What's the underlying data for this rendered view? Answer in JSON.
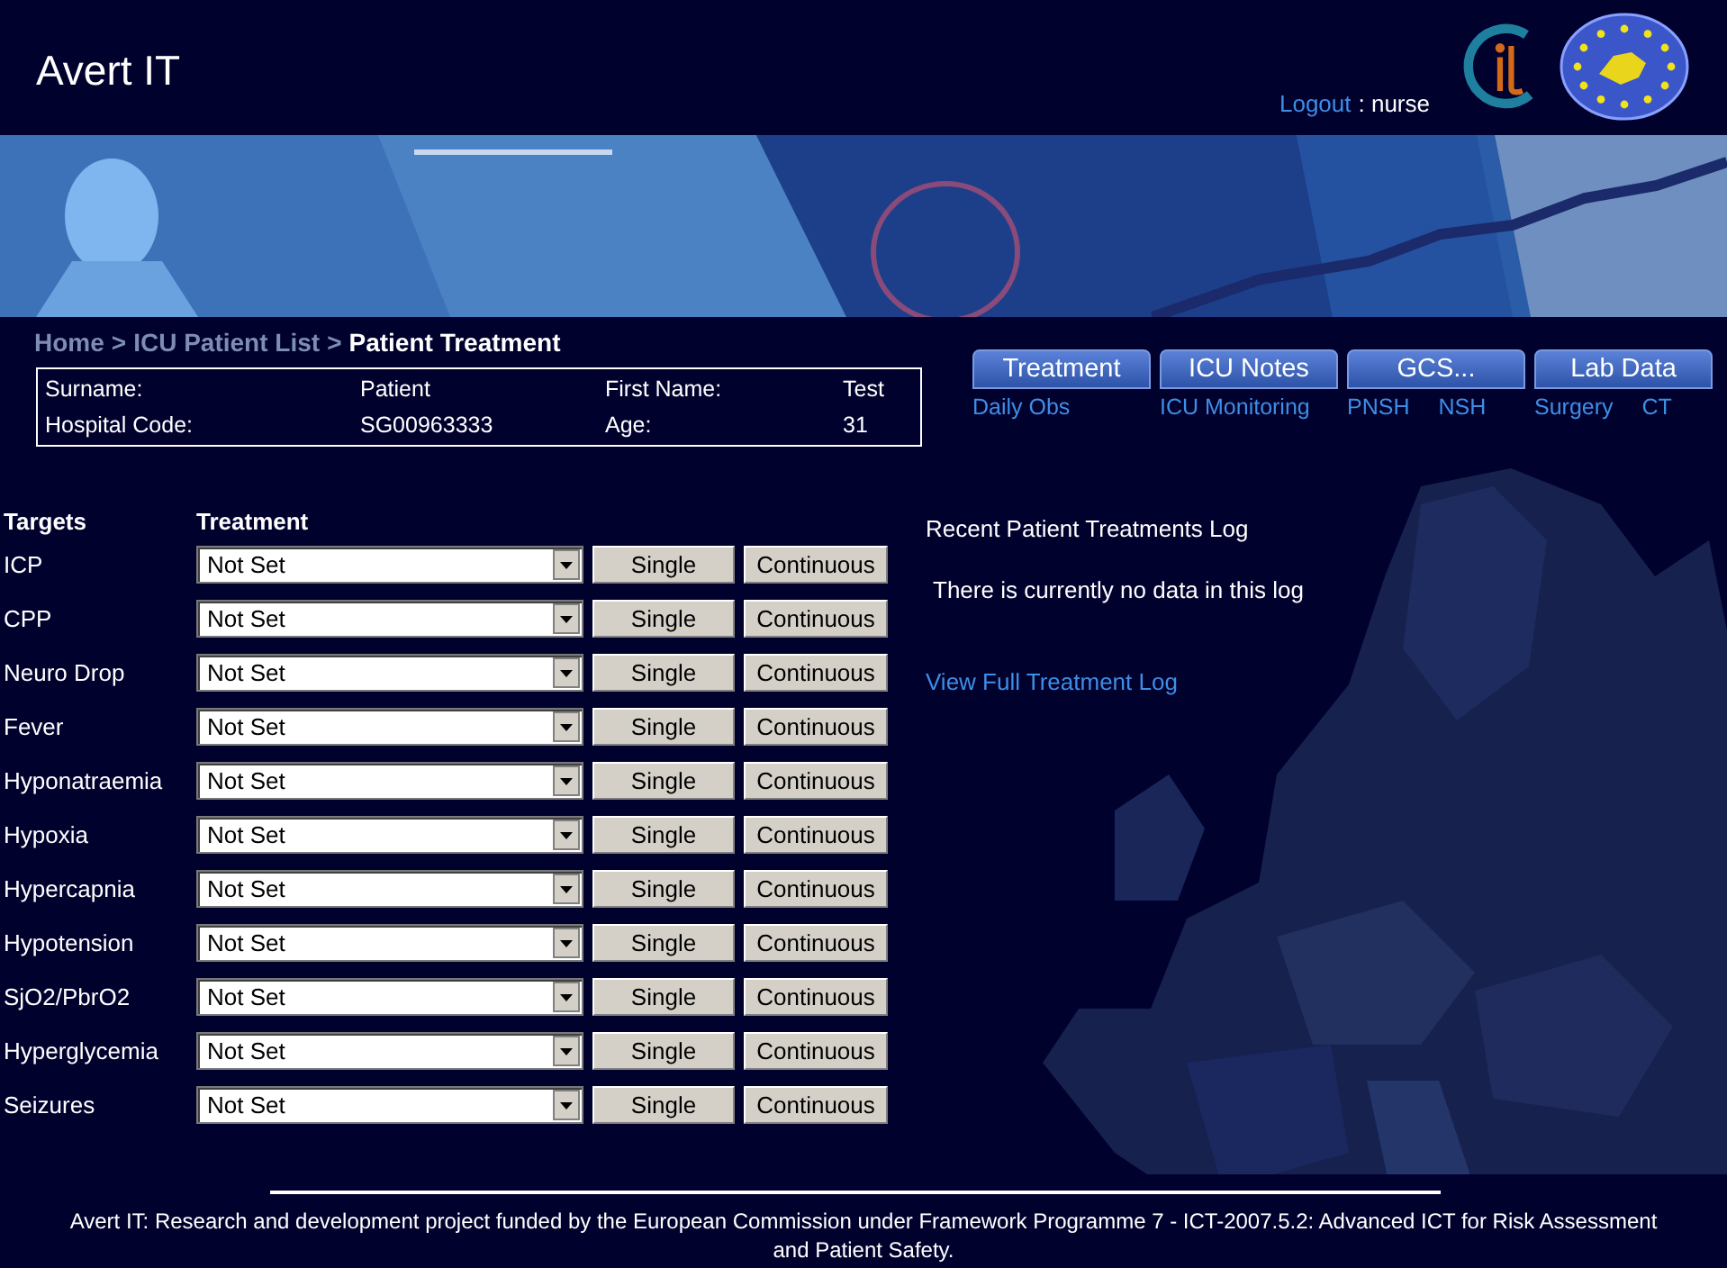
{
  "header": {
    "title": "Avert IT",
    "logout": "Logout",
    "user": ": nurse"
  },
  "breadcrumb": {
    "separator": ">",
    "items": [
      {
        "label": "Home",
        "current": false
      },
      {
        "label": "ICU Patient List",
        "current": false
      },
      {
        "label": "Patient Treatment",
        "current": true
      }
    ]
  },
  "patient": [
    {
      "label": "Surname:",
      "value": "Patient"
    },
    {
      "label": "First Name:",
      "value": "Test"
    },
    {
      "label": "Hospital Code:",
      "value": "SG00963333"
    },
    {
      "label": "Age:",
      "value": "31"
    }
  ],
  "nav": [
    {
      "button": "Treatment",
      "links": [
        "Daily Obs"
      ]
    },
    {
      "button": "ICU Notes",
      "links": [
        "ICU Monitoring"
      ]
    },
    {
      "button": "GCS...",
      "links": [
        "PNSH",
        "NSH"
      ]
    },
    {
      "button": "Lab Data",
      "links": [
        "Surgery",
        "CT"
      ]
    }
  ],
  "targets": {
    "columns": [
      "Targets",
      "Treatment"
    ],
    "rows": [
      {
        "name": "ICP",
        "treatment": "Not Set",
        "buttons": [
          "Single",
          "Continuous"
        ]
      },
      {
        "name": "CPP",
        "treatment": "Not Set",
        "buttons": [
          "Single",
          "Continuous"
        ]
      },
      {
        "name": "Neuro Drop",
        "treatment": "Not Set",
        "buttons": [
          "Single",
          "Continuous"
        ]
      },
      {
        "name": "Fever",
        "treatment": "Not Set",
        "buttons": [
          "Single",
          "Continuous"
        ]
      },
      {
        "name": "Hyponatraemia",
        "treatment": "Not Set",
        "buttons": [
          "Single",
          "Continuous"
        ]
      },
      {
        "name": "Hypoxia",
        "treatment": "Not Set",
        "buttons": [
          "Single",
          "Continuous"
        ]
      },
      {
        "name": "Hypercapnia",
        "treatment": "Not Set",
        "buttons": [
          "Single",
          "Continuous"
        ]
      },
      {
        "name": "Hypotension",
        "treatment": "Not Set",
        "buttons": [
          "Single",
          "Continuous"
        ]
      },
      {
        "name": "SjO2/PbrO2",
        "treatment": "Not Set",
        "buttons": [
          "Single",
          "Continuous"
        ]
      },
      {
        "name": "Hyperglycemia",
        "treatment": "Not Set",
        "buttons": [
          "Single",
          "Continuous"
        ]
      },
      {
        "name": "Seizures",
        "treatment": "Not Set",
        "buttons": [
          "Single",
          "Continuous"
        ]
      }
    ]
  },
  "log": {
    "title": "Recent Patient Treatments Log",
    "message": "There is currently no data in this log",
    "link": "View Full Treatment Log"
  },
  "footer": "Avert IT: Research and development project funded by the European Commission under Framework Programme 7 - ICT-2007.5.2: Advanced ICT for Risk Assessment and Patient Safety."
}
